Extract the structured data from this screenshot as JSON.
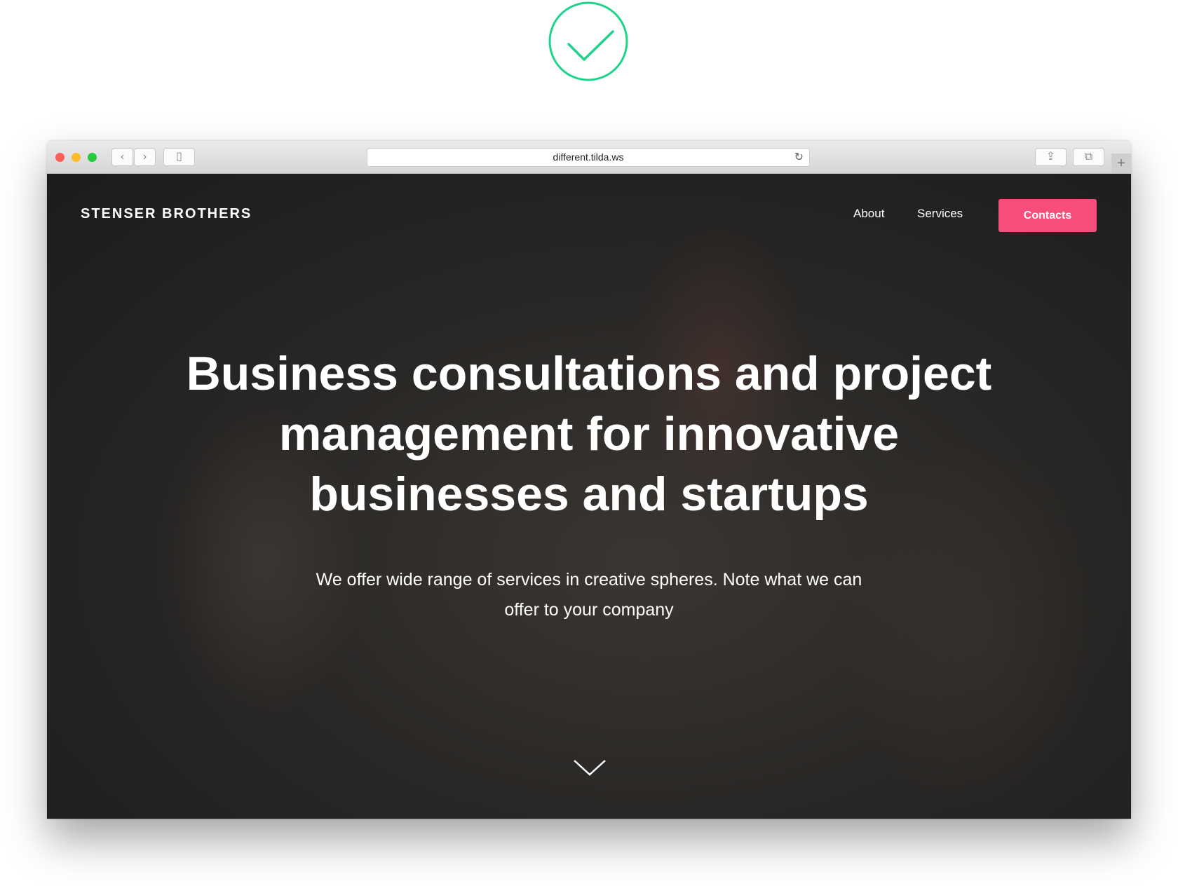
{
  "colors": {
    "check": "#1ed48a",
    "accent": "#f74d7b"
  },
  "browser": {
    "url": "different.tilda.ws",
    "icons": [
      "back-icon",
      "forward-icon",
      "sidebar-icon",
      "reload-icon",
      "share-icon",
      "tabs-icon",
      "new-tab-icon"
    ]
  },
  "site": {
    "logo": "STENSER BROTHERS",
    "nav": {
      "about": "About",
      "services": "Services",
      "contacts": "Contacts"
    },
    "hero": {
      "title": "Business consultations and project management for innovative businesses and startups",
      "subtitle": "We offer wide range of services in creative spheres. Note what we can offer to your company"
    }
  }
}
